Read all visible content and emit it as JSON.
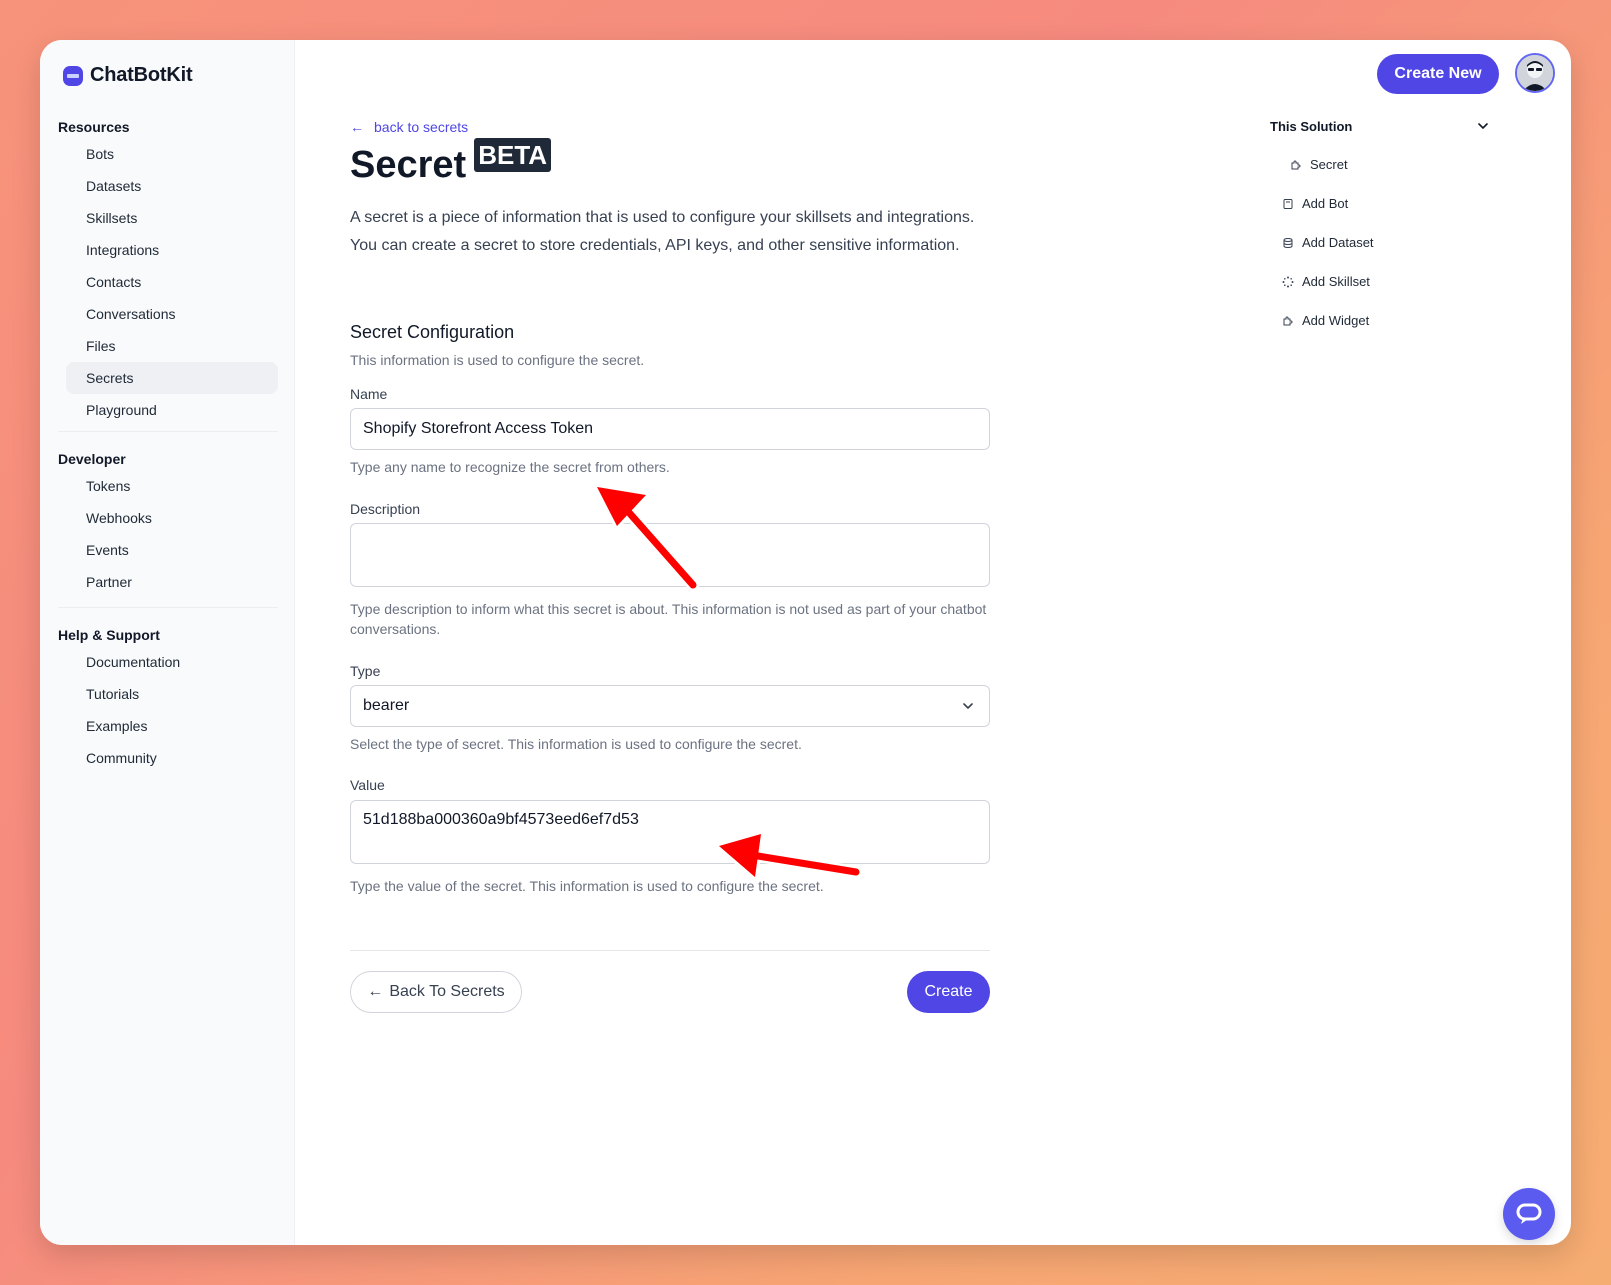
{
  "app": {
    "name": "ChatBotKit"
  },
  "topbar": {
    "create_new_label": "Create New"
  },
  "sidebar": {
    "resources_title": "Resources",
    "resources": [
      "Bots",
      "Datasets",
      "Skillsets",
      "Integrations",
      "Contacts",
      "Conversations",
      "Files",
      "Secrets",
      "Playground"
    ],
    "active_item": "Secrets",
    "developer_title": "Developer",
    "developer": [
      "Tokens",
      "Webhooks",
      "Events",
      "Partner"
    ],
    "help_title": "Help & Support",
    "help": [
      "Documentation",
      "Tutorials",
      "Examples",
      "Community"
    ]
  },
  "page": {
    "back_link": "back to secrets",
    "title": "Secret",
    "badge": "BETA",
    "intro": "A secret is a piece of information that is used to configure your skillsets and integrations. You can create a secret to store credentials, API keys, and other sensitive information."
  },
  "form": {
    "section_title": "Secret Configuration",
    "section_desc": "This information is used to configure the secret.",
    "name_label": "Name",
    "name_value": "Shopify Storefront Access Token",
    "name_hint": "Type any name to recognize the secret from others.",
    "description_label": "Description",
    "description_value": "",
    "description_hint": "Type description to inform what this secret is about. This information is not used as part of your chatbot conversations.",
    "type_label": "Type",
    "type_value": "bearer",
    "type_hint": "Select the type of secret. This information is used to configure the secret.",
    "value_label": "Value",
    "value_value": "51d188ba000360a9bf4573eed6ef7d53",
    "value_hint": "Type the value of the secret. This information is used to configure the secret.",
    "back_button": "Back To Secrets",
    "create_button": "Create"
  },
  "right_panel": {
    "title": "This Solution",
    "items": [
      {
        "label": "Secret",
        "icon": "puzzle-icon"
      },
      {
        "label": "Add Bot",
        "icon": "bot-icon"
      },
      {
        "label": "Add Dataset",
        "icon": "database-icon"
      },
      {
        "label": "Add Skillset",
        "icon": "skillset-icon"
      },
      {
        "label": "Add Widget",
        "icon": "widget-icon"
      }
    ]
  },
  "colors": {
    "accent": "#4f46e5",
    "annotation": "#ff0000"
  }
}
